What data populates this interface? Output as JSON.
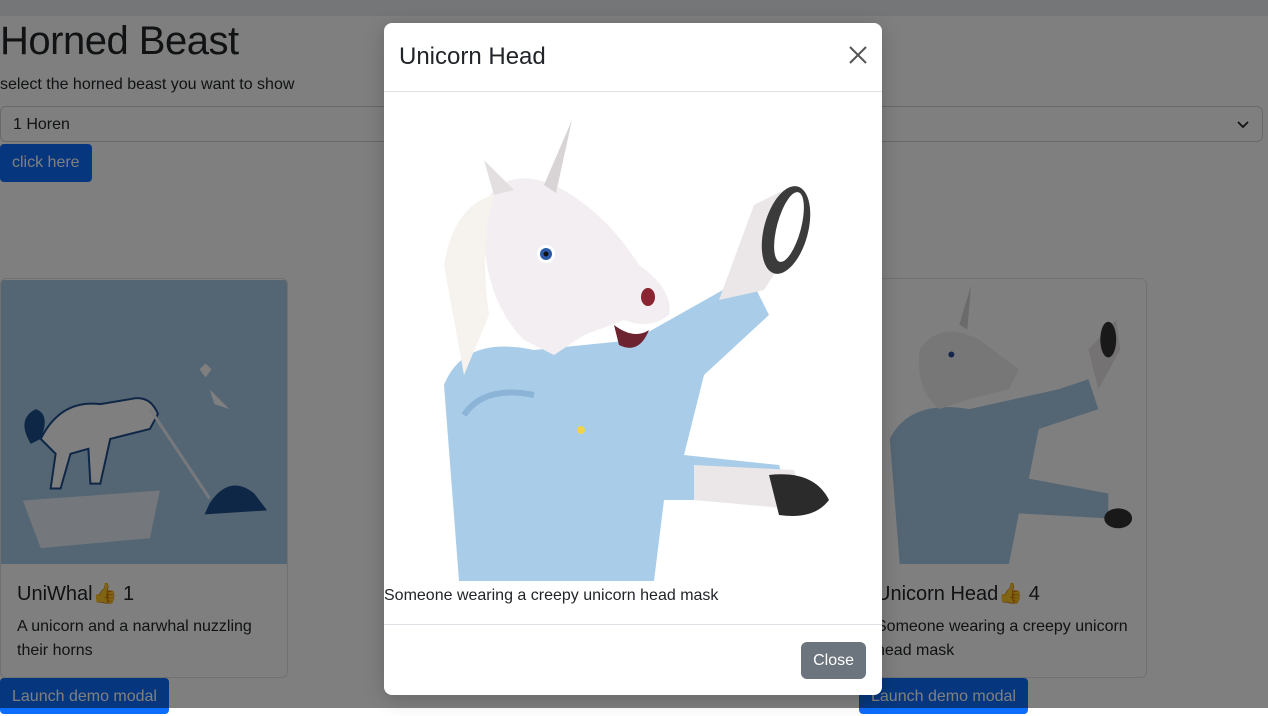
{
  "page": {
    "title": "Horned Beast",
    "subtitle": "select the horned beast you want to show",
    "select_value": "1 Horen",
    "click_button": "click here"
  },
  "cards": [
    {
      "title": "UniWhal👍 1",
      "text": "A unicorn and a narwhal nuzzling their horns",
      "button": "Launch demo modal"
    },
    {
      "title": "Unicorn Head👍 4",
      "text": "Someone wearing a creepy unicorn head mask",
      "button": "Launch demo modal"
    }
  ],
  "modal": {
    "title": "Unicorn Head",
    "description": "Someone wearing a creepy unicorn head mask",
    "close_button": "Close"
  },
  "colors": {
    "primary": "#0d6efd",
    "secondary": "#6c757d",
    "backdrop": "rgba(0,0,0,0.5)"
  },
  "icons": {
    "select_chevron": "chevron-down-icon",
    "modal_close": "close-icon"
  }
}
